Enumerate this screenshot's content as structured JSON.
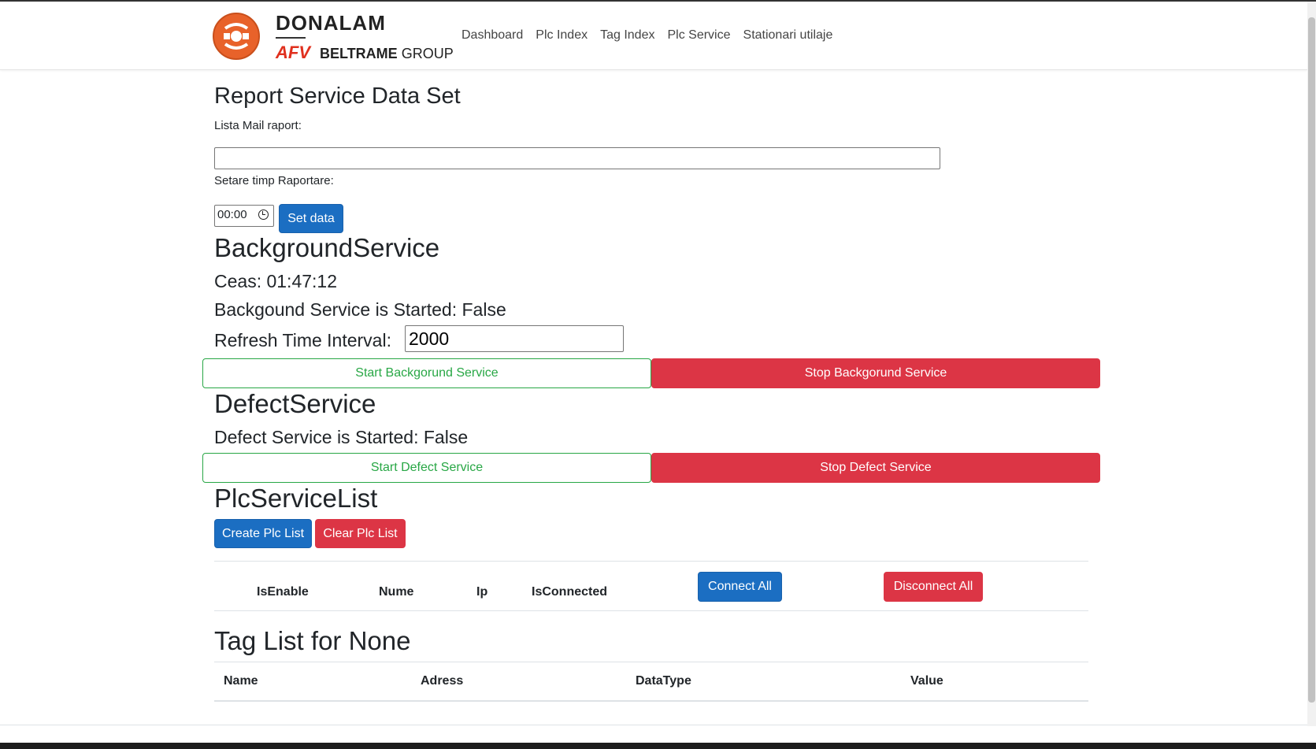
{
  "navbar": {
    "brand_name": "DONALAM",
    "brand_sub_afv": "AFV",
    "brand_sub_beltrame": "BELTRAME",
    "brand_sub_group": "GROUP",
    "links": [
      "Dashboard",
      "Plc Index",
      "Tag Index",
      "Plc Service",
      "Stationari utilaje"
    ]
  },
  "report": {
    "title": "Report Service Data Set",
    "mail_label": "Lista Mail raport:",
    "mail_value": "",
    "time_label": "Setare timp Raportare:",
    "time_value": "00:00",
    "set_button": "Set data"
  },
  "background": {
    "title": "BackgroundService",
    "clock": "Ceas: 01:47:12",
    "status": "Backgound Service is Started: False",
    "refresh_label": "Refresh Time Interval:",
    "refresh_value": "2000",
    "start_button": "Start Backgorund Service",
    "stop_button": "Stop Backgorund Service"
  },
  "defect": {
    "title": "DefectService",
    "status": "Defect Service is Started: False",
    "start_button": "Start Defect Service",
    "stop_button": "Stop Defect Service"
  },
  "plc": {
    "title": "PlcServiceList",
    "create_button": "Create Plc List",
    "clear_button": "Clear Plc List",
    "columns": [
      "IsEnable",
      "Nume",
      "Ip",
      "IsConnected"
    ],
    "connect_all": "Connect All",
    "disconnect_all": "Disconnect All"
  },
  "tags": {
    "title": "Tag List for None",
    "columns": [
      "Name",
      "Adress",
      "DataType",
      "Value"
    ]
  },
  "colors": {
    "primary": "#1b6ec2",
    "danger": "#dc3545",
    "success": "#28a745",
    "brand_orange": "#e8622a"
  }
}
